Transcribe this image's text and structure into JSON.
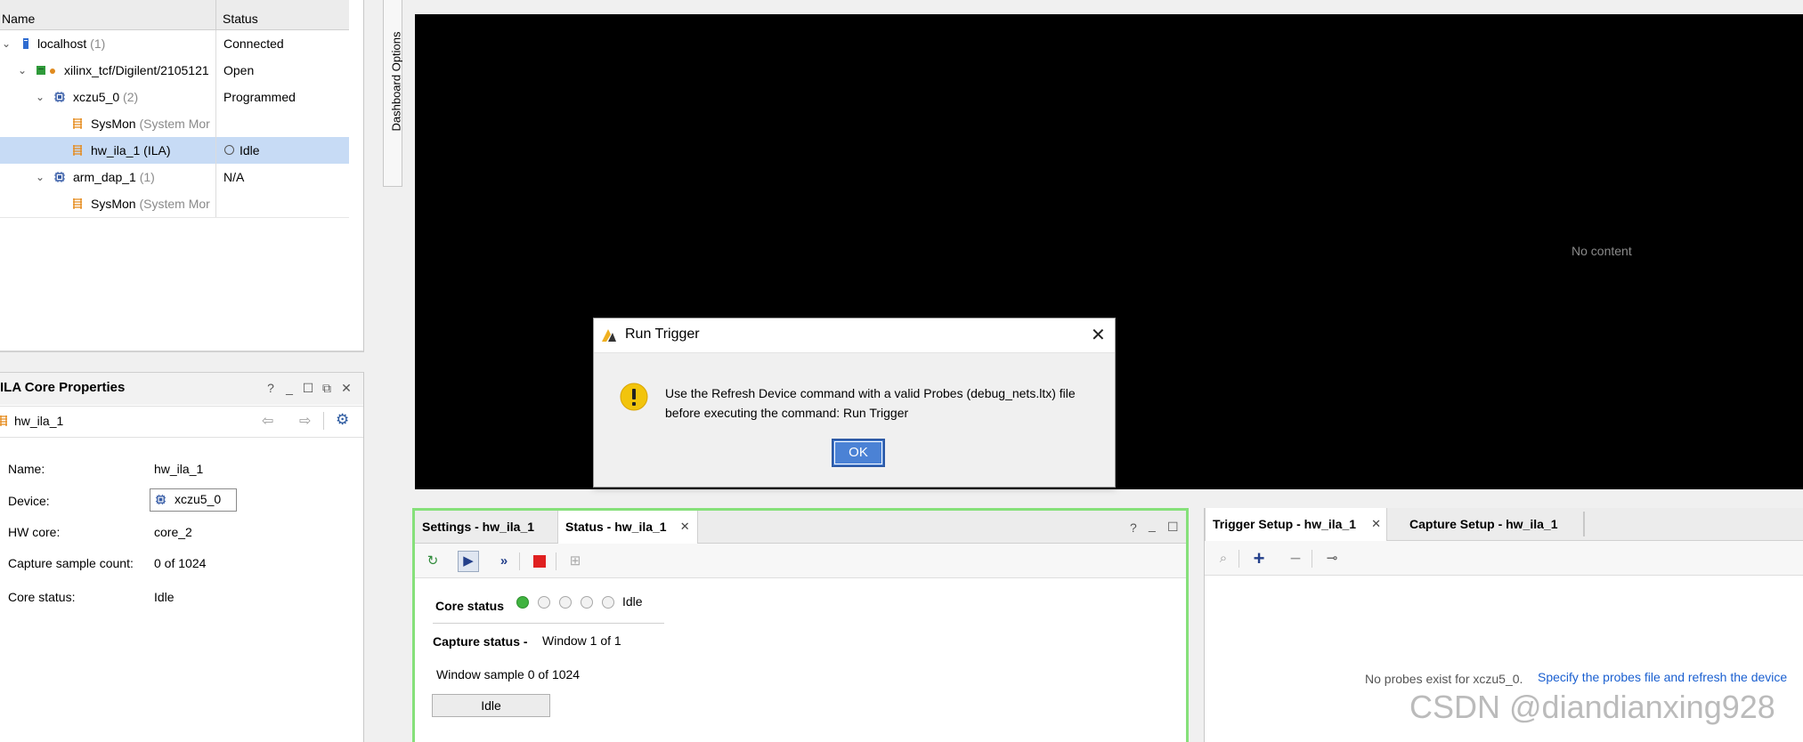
{
  "hardware_tree": {
    "columns": [
      "Name",
      "Status"
    ],
    "rows": [
      {
        "name": "localhost",
        "count": "(1)",
        "status": "Connected",
        "icon": "host-icon"
      },
      {
        "name": "xilinx_tcf/Digilent/2105121",
        "count": "",
        "status": "Open",
        "icon": "target-icon"
      },
      {
        "name": "xczu5_0",
        "count": "(2)",
        "status": "Programmed",
        "icon": "chip-icon"
      },
      {
        "name": "SysMon",
        "count": "(System Mor",
        "status": "",
        "icon": "core-icon"
      },
      {
        "name": "hw_ila_1 (ILA)",
        "count": "",
        "status": "Idle",
        "icon": "core-icon"
      },
      {
        "name": "arm_dap_1",
        "count": "(1)",
        "status": "N/A",
        "icon": "chip-icon"
      },
      {
        "name": "SysMon",
        "count": "(System Mor",
        "status": "",
        "icon": "core-icon"
      }
    ]
  },
  "properties": {
    "title": "ILA Core Properties",
    "object_name": "hw_ila_1",
    "rows": [
      {
        "label": "Name:",
        "value": "hw_ila_1"
      },
      {
        "label": "Device:",
        "value": "xczu5_0"
      },
      {
        "label": "HW core:",
        "value": "core_2"
      },
      {
        "label": "Capture sample count:",
        "value": "0 of 1024"
      },
      {
        "label": "Core status:",
        "value": "Idle"
      }
    ]
  },
  "dashboard": {
    "label": "Dashboard Options"
  },
  "waveform": {
    "no_content": "No content"
  },
  "status_panel": {
    "tabs": [
      "Settings - hw_ila_1",
      "Status - hw_ila_1"
    ],
    "core_status_label": "Core status",
    "core_status_value": "Idle",
    "capture_status_label": "Capture status -",
    "capture_status_value": "Window 1 of 1",
    "window_sample": "Window sample 0 of 1024",
    "state_button": "Idle"
  },
  "trigger_panel": {
    "tabs": [
      "Trigger Setup - hw_ila_1",
      "Capture Setup - hw_ila_1"
    ],
    "message": "No probes exist for xczu5_0.",
    "link": "Specify the probes file and refresh the device"
  },
  "dialog": {
    "title": "Run Trigger",
    "message_line1": "Use the Refresh Device command with a valid Probes (debug_nets.ltx) file",
    "message_line2": "before executing the command: Run Trigger",
    "ok": "OK"
  },
  "watermark": "CSDN @diandianxing928",
  "colors": {
    "selection": "#c7dbf5",
    "accent": "#4b82d5",
    "green": "#40b340",
    "red": "#e02020",
    "link": "#1a5fd0"
  }
}
